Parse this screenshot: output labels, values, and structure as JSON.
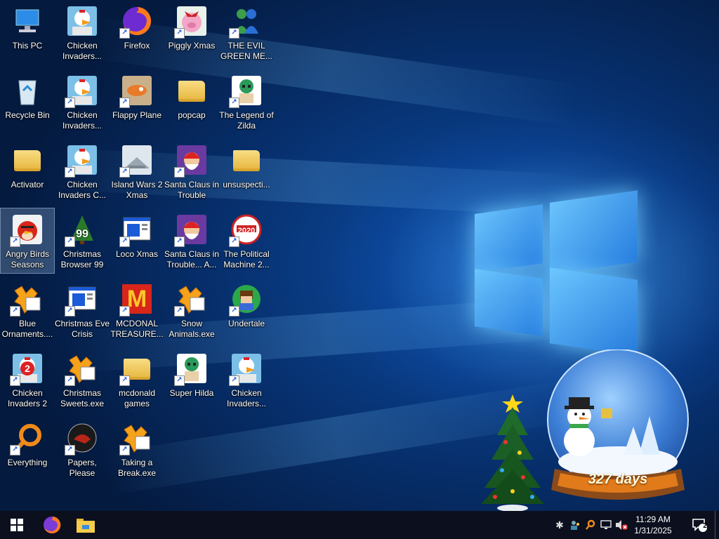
{
  "desktop": {
    "icons": [
      {
        "label": "This PC",
        "icon": "computer-icon"
      },
      {
        "label": "Chicken Invaders...",
        "icon": "chicken-icon"
      },
      {
        "label": "Firefox",
        "icon": "firefox-icon"
      },
      {
        "label": "Piggly Xmas",
        "icon": "pig-icon"
      },
      {
        "label": "THE EVIL GREEN ME...",
        "icon": "messenger-icon"
      },
      {
        "label": "Recycle Bin",
        "icon": "recycle-bin-icon"
      },
      {
        "label": "Chicken Invaders...",
        "icon": "chicken-icon"
      },
      {
        "label": "Flappy Plane",
        "icon": "plane-icon"
      },
      {
        "label": "popcap",
        "icon": "folder-icon"
      },
      {
        "label": "The Legend of Zilda",
        "icon": "game-icon"
      },
      {
        "label": "Activator",
        "icon": "folder-icon"
      },
      {
        "label": "Chicken Invaders C...",
        "icon": "chicken-icon"
      },
      {
        "label": "Island Wars 2 Xmas",
        "icon": "island-icon"
      },
      {
        "label": "Santa Claus in Trouble",
        "icon": "santa-icon"
      },
      {
        "label": "unsuspecti...",
        "icon": "folder-icon"
      },
      {
        "label": "Angry Birds Seasons",
        "icon": "angry-bird-icon"
      },
      {
        "label": "Christmas Browser 99",
        "icon": "xmas-tree-icon"
      },
      {
        "label": "Loco Xmas",
        "icon": "window-icon"
      },
      {
        "label": "Santa Claus in Trouble... A...",
        "icon": "santa-icon"
      },
      {
        "label": "The Political Machine 2...",
        "icon": "political-icon"
      },
      {
        "label": "Blue Ornaments....",
        "icon": "exe-icon"
      },
      {
        "label": "Christmas Eve Crisis",
        "icon": "window-icon"
      },
      {
        "label": "MCDONAL TREASURE...",
        "icon": "mcdonalds-icon"
      },
      {
        "label": "Snow Animals.exe",
        "icon": "exe-icon"
      },
      {
        "label": "Undertale",
        "icon": "undertale-icon"
      },
      {
        "label": "Chicken Invaders 2",
        "icon": "chicken-icon"
      },
      {
        "label": "Christmas Sweets.exe",
        "icon": "exe-icon"
      },
      {
        "label": "mcdonald games",
        "icon": "folder-icon"
      },
      {
        "label": "Super Hilda",
        "icon": "game-icon"
      },
      {
        "label": "Chicken Invaders...",
        "icon": "chicken-icon"
      },
      {
        "label": "Everything",
        "icon": "search-icon"
      },
      {
        "label": "Papers, Please",
        "icon": "papers-icon"
      },
      {
        "label": "Taking a Break.exe",
        "icon": "exe-icon"
      }
    ],
    "selected_label": "Angry Birds Seasons",
    "mcdonalds_glyph": "M",
    "christmas_browser_badge": "99",
    "chicken_invaders_2_badge": "2",
    "political_badge": "2020"
  },
  "widget": {
    "days_text": "327 days"
  },
  "taskbar": {
    "pinned": [
      {
        "icon": "windows-start-icon"
      },
      {
        "icon": "firefox-icon"
      },
      {
        "icon": "file-explorer-icon"
      }
    ],
    "tray": [
      "sparkle-icon",
      "people-icon",
      "search-tray-icon",
      "network-icon",
      "volume-muted-icon"
    ],
    "time": "11:29 AM",
    "date": "1/31/2025",
    "notification_count": "2"
  },
  "colors": {
    "accent": "#1c5bd6",
    "taskbar": "#0b0f1e",
    "desktop_background": "#07306e"
  }
}
